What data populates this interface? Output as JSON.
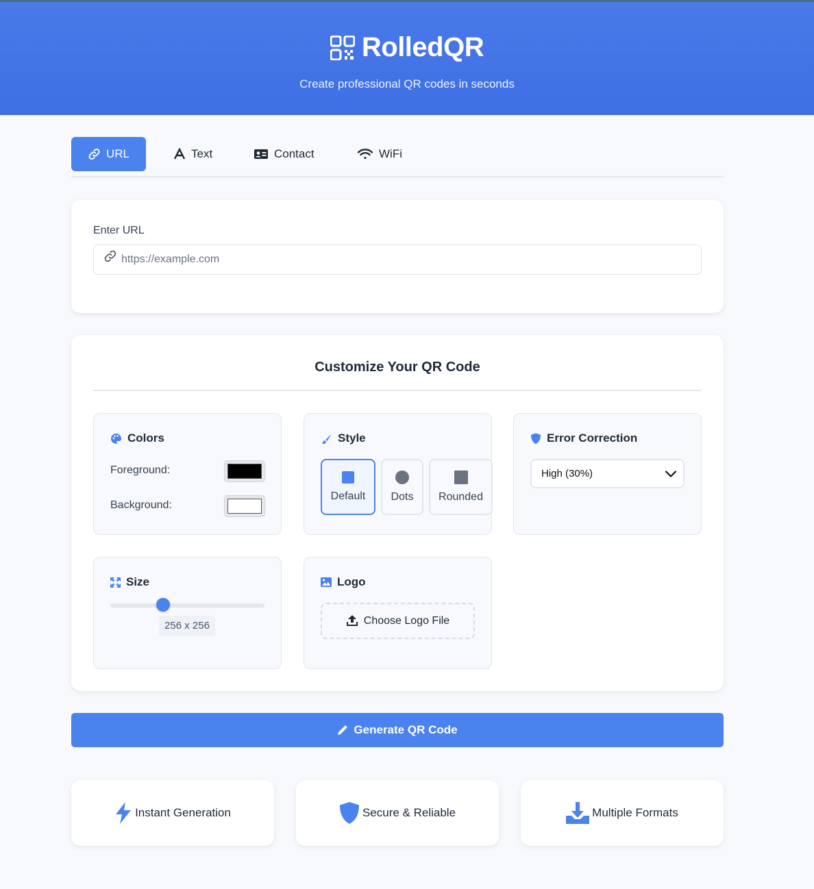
{
  "header": {
    "title": "RolledQR",
    "tagline": "Create professional QR codes in seconds"
  },
  "tabs": [
    {
      "label": "URL",
      "icon": "link-icon",
      "active": true
    },
    {
      "label": "Text",
      "icon": "font-icon",
      "active": false
    },
    {
      "label": "Contact",
      "icon": "id-card-icon",
      "active": false
    },
    {
      "label": "WiFi",
      "icon": "wifi-icon",
      "active": false
    }
  ],
  "url_form": {
    "label": "Enter URL",
    "placeholder": "https://example.com",
    "value": ""
  },
  "customize": {
    "title": "Customize Your QR Code",
    "colors": {
      "heading": "Colors",
      "foreground_label": "Foreground:",
      "foreground_color": "#000000",
      "background_label": "Background:",
      "background_color": "#ffffff"
    },
    "style": {
      "heading": "Style",
      "options": [
        {
          "label": "Default",
          "active": true
        },
        {
          "label": "Dots",
          "active": false
        },
        {
          "label": "Rounded",
          "active": false
        }
      ]
    },
    "error_correction": {
      "heading": "Error Correction",
      "selected": "High (30%)"
    },
    "size": {
      "heading": "Size",
      "value_label": "256 x 256",
      "slider_fraction": 0.34
    },
    "logo": {
      "heading": "Logo",
      "button_label": "Choose Logo File"
    }
  },
  "generate_button": "Generate QR Code",
  "features": [
    {
      "label": "Instant Generation",
      "icon": "bolt-icon"
    },
    {
      "label": "Secure & Reliable",
      "icon": "shield-icon"
    },
    {
      "label": "Multiple Formats",
      "icon": "download-icon"
    }
  ],
  "colors": {
    "accent": "#4a82ee",
    "header": "#3e6fe4",
    "page_bg": "#f7f9fc"
  }
}
